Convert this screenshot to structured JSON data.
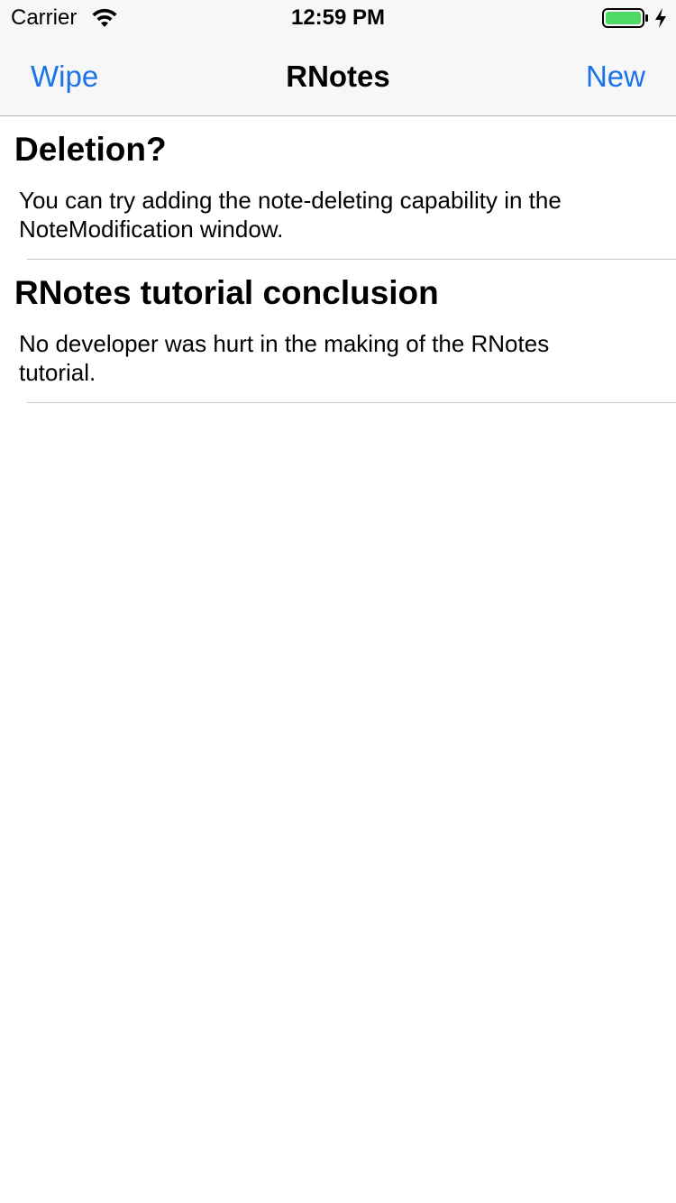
{
  "status_bar": {
    "carrier": "Carrier",
    "time": "12:59 PM",
    "icons": [
      "wifi-icon",
      "battery-icon",
      "charging-bolt-icon"
    ],
    "battery_color": "#4cd964"
  },
  "nav_bar": {
    "left_button": "Wipe",
    "title": "RNotes",
    "right_button": "New",
    "accent_color": "#1a73e8"
  },
  "notes": [
    {
      "title": "Deletion?",
      "body": "You can try adding the note-deleting capability in the NoteModification window."
    },
    {
      "title": "RNotes tutorial conclusion",
      "body": "No developer was hurt in the making of the RNotes tutorial."
    }
  ]
}
